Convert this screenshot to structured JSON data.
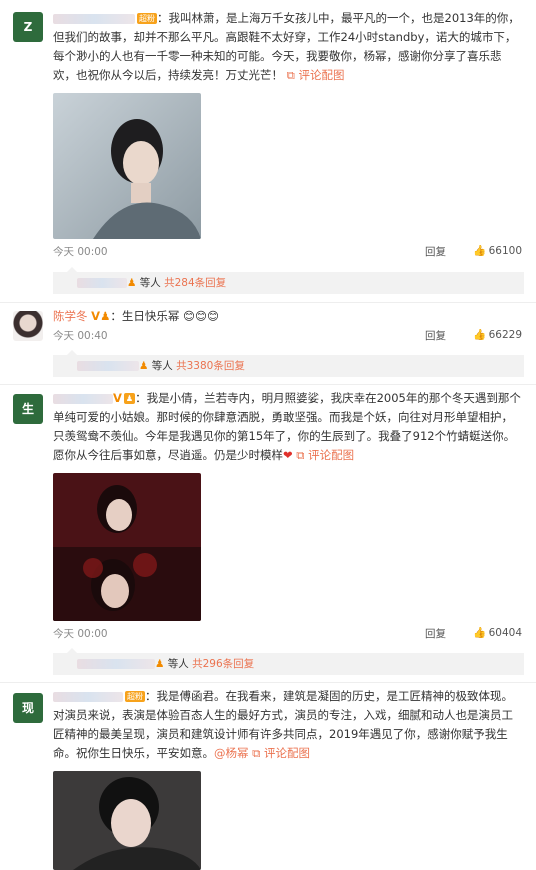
{
  "comments": [
    {
      "text": "：我叫林萧，是上海万千女孩儿中，最平凡的一个，也是2013年的你，但我们的故事，却并不那么平凡。高跟鞋不太好穿，工作24小时standby，诺大的城市下，每个渺小的人也有一千零一种未知的可能。今天，我要敬你，杨幂，感谢你分享了喜乐悲欢，也祝你从今以后，持续发亮！万丈光芒！",
      "link": "评论配图",
      "time": "今天 00:00",
      "reply": "回复",
      "likes": "66100",
      "replies_prefix": "等人",
      "replies_count": "共284条回复"
    },
    {
      "name": "陈学冬",
      "text": "：生日快乐幂",
      "time": "今天 00:40",
      "reply": "回复",
      "likes": "66229",
      "replies_prefix": "等人",
      "replies_count": "共3380条回复"
    },
    {
      "avatar_text": "生",
      "text": "：我是小倩，兰若寺内，明月照婆娑，我庆幸在2005年的那个冬天遇到那个单纯可爱的小姑娘。那时候的你肆意洒脱，勇敢坚强。而我是个妖，向往对月形单望相护，只羡鸳鸯不羡仙。今年是我遇见你的第15年了，你的生辰到了。我叠了912个竹蜻蜓送你。愿你从今往后事如意，尽逍遥。仍是少时模样",
      "link": "评论配图",
      "time": "今天 00:00",
      "reply": "回复",
      "likes": "60404",
      "replies_prefix": "等人",
      "replies_count": "共296条回复"
    },
    {
      "avatar_text": "现",
      "text": "：我是傅函君。在我看来，建筑是凝固的历史，是工匠精神的极致体现。对演员来说，表演是体验百态人生的最好方式，演员的专注，入戏，细腻和动人也是演员工匠精神的最美呈现，演员和建筑设计师有许多共同点，2019年遇见了你，感谢你赋予我生命。祝你生日快乐，平安如意。",
      "mention": "@杨幂",
      "link": "评论配图"
    }
  ],
  "badge_label": "超粉",
  "colors": {
    "accent": "#eb7350",
    "badge": "#f7a21b",
    "avatar_green": "#2e6b3c"
  }
}
